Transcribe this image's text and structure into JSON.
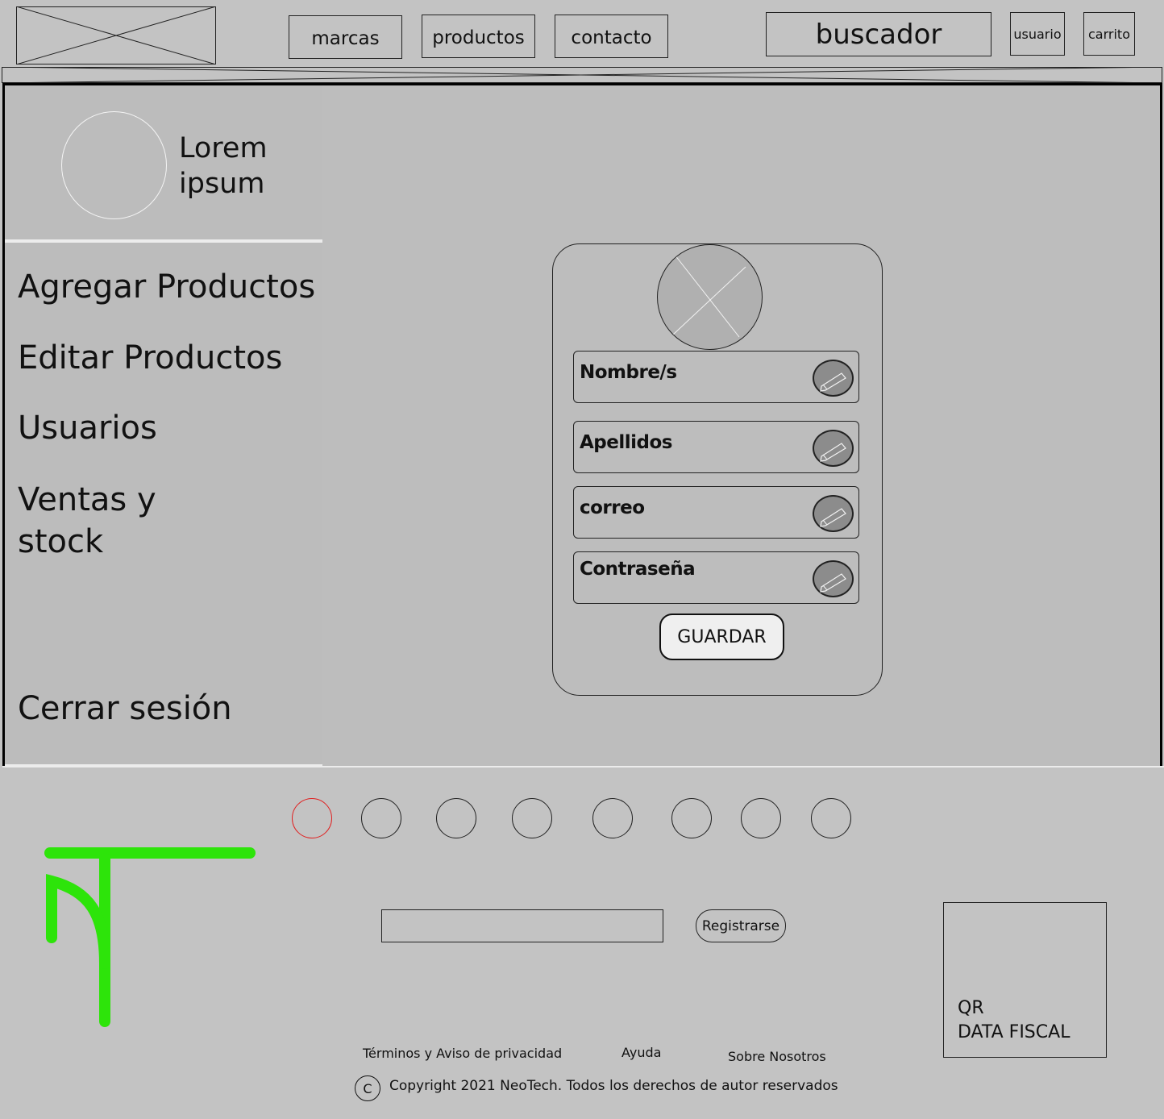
{
  "header": {
    "nav": [
      {
        "label": "marcas"
      },
      {
        "label": "productos"
      },
      {
        "label": "contacto"
      }
    ],
    "search_label": "buscador",
    "user_label": "usuario",
    "cart_label": "carrito"
  },
  "sidebar": {
    "profile_name_line1": "Lorem",
    "profile_name_line2": "ipsum",
    "items": [
      {
        "label": "Agregar Productos"
      },
      {
        "label": "Editar Productos"
      },
      {
        "label": "Usuarios"
      },
      {
        "label": "Ventas y"
      },
      {
        "label": "stock"
      }
    ],
    "logout_label": "Cerrar sesión"
  },
  "profile_form": {
    "fields": [
      {
        "label": "Nombre/s",
        "icon": "pencil-icon"
      },
      {
        "label": "Apellidos",
        "icon": "pencil-icon"
      },
      {
        "label": "correo",
        "icon": "pencil-icon"
      },
      {
        "label": "Contraseña",
        "icon": "pencil-icon"
      }
    ],
    "save_label": "GUARDAR"
  },
  "footer": {
    "social_count": 8,
    "active_social_color": "#e02020",
    "logo_color": "#2de40a",
    "newsletter_value": "",
    "register_label": "Registrarse",
    "qr_line1": "QR",
    "qr_line2": "DATA FISCAL",
    "links": [
      {
        "label": "Términos y Aviso de privacidad"
      },
      {
        "label": "Ayuda"
      },
      {
        "label": "Sobre Nosotros"
      }
    ],
    "copyright_symbol": "C",
    "copyright": "Copyright 2021 NeoTech. Todos los derechos de autor reservados"
  }
}
